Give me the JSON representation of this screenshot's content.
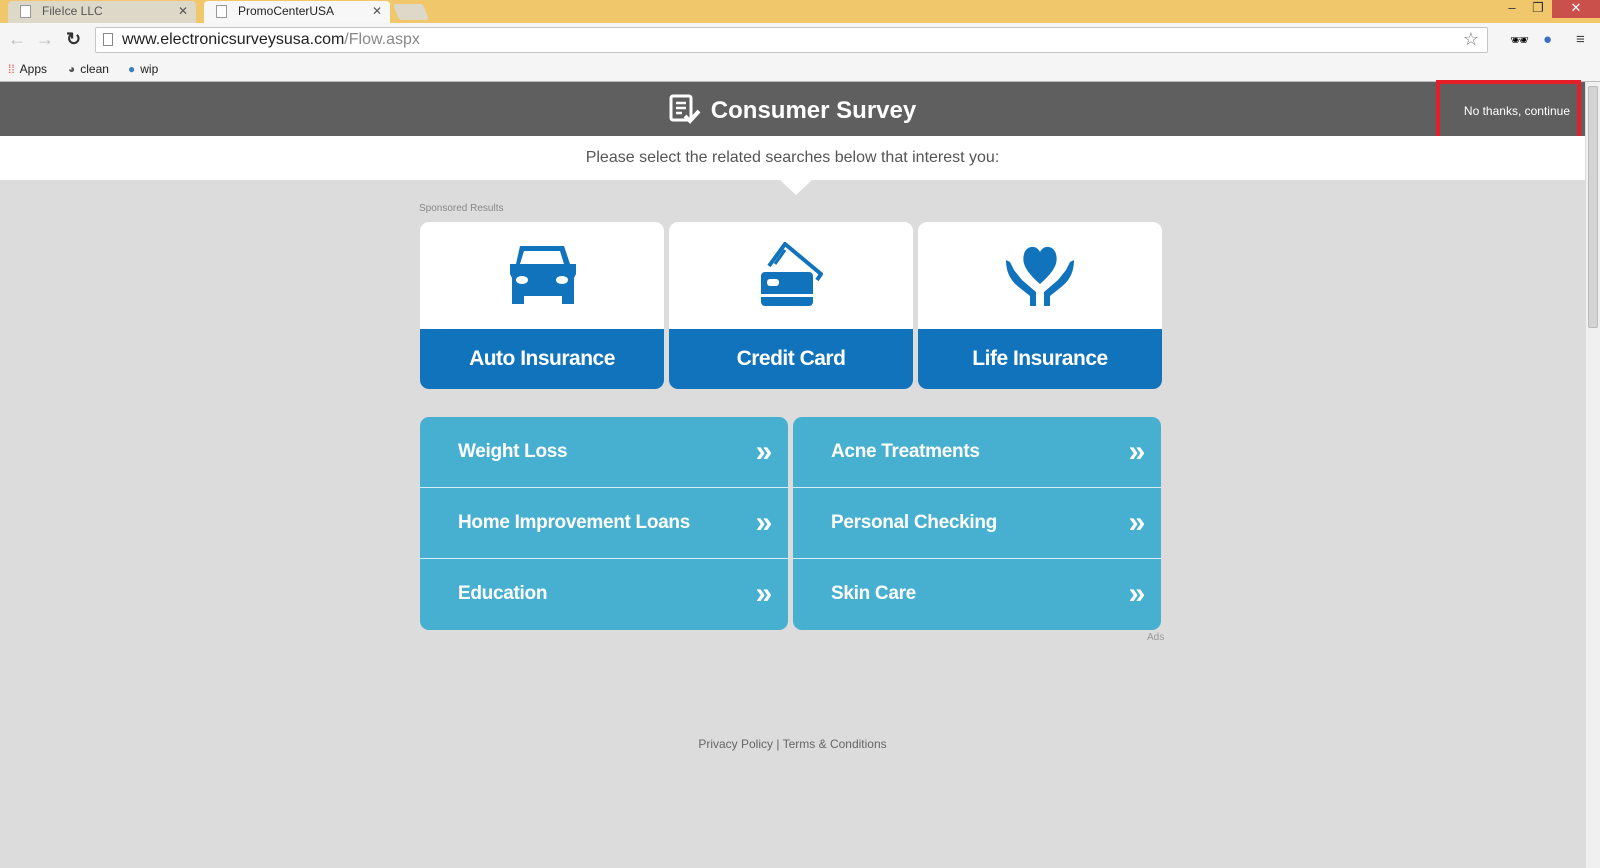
{
  "browser": {
    "tabs": [
      {
        "label": "FileIce LLC"
      },
      {
        "label": "PromoCenterUSA"
      }
    ],
    "url": {
      "host": "www.electronicsurveysusa.com",
      "path": "/Flow.aspx"
    },
    "bookmarks": [
      {
        "label": "Apps"
      },
      {
        "label": "clean"
      },
      {
        "label": "wip"
      }
    ]
  },
  "header": {
    "title": "Consumer Survey",
    "no_thanks": "No thanks, continue"
  },
  "subtitle": "Please select the related searches below that interest you:",
  "sponsored_label": "Sponsored Results",
  "cards": [
    {
      "label": "Auto Insurance",
      "icon": "car-icon"
    },
    {
      "label": "Credit Card",
      "icon": "credit-card-icon"
    },
    {
      "label": "Life Insurance",
      "icon": "heart-hands-icon"
    }
  ],
  "links_left": [
    {
      "label": "Weight Loss"
    },
    {
      "label": "Home Improvement Loans"
    },
    {
      "label": "Education"
    }
  ],
  "links_right": [
    {
      "label": "Acne Treatments"
    },
    {
      "label": "Personal Checking"
    },
    {
      "label": "Skin Care"
    }
  ],
  "ads_label": "Ads",
  "footer": {
    "privacy": "Privacy Policy",
    "separator": "|",
    "terms": "Terms & Conditions"
  },
  "colors": {
    "header": "#5f5f5f",
    "card_blue": "#1173bc",
    "link_blue": "#47b0d0",
    "highlight": "#e61e2a"
  }
}
